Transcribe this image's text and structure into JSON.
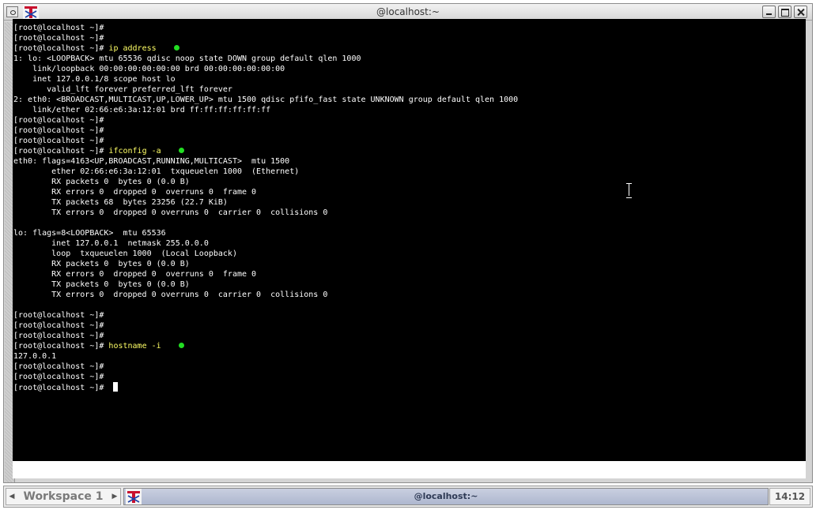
{
  "window": {
    "title": "@localhost:~"
  },
  "terminal": {
    "colors": {
      "background": "#000000",
      "text": "#ffffff",
      "command": "#ffff66",
      "marker": "#22dd22"
    },
    "lines": [
      {
        "text": "[root@localhost ~]#"
      },
      {
        "text": "[root@localhost ~]#"
      },
      {
        "text": "[root@localhost ~]# ",
        "cmd": "ip address",
        "marker": true
      },
      {
        "text": "1: lo: <LOOPBACK> mtu 65536 qdisc noop state DOWN group default qlen 1000"
      },
      {
        "text": "    link/loopback 00:00:00:00:00:00 brd 00:00:00:00:00:00"
      },
      {
        "text": "    inet 127.0.0.1/8 scope host lo"
      },
      {
        "text": "       valid_lft forever preferred_lft forever"
      },
      {
        "text": "2: eth0: <BROADCAST,MULTICAST,UP,LOWER_UP> mtu 1500 qdisc pfifo_fast state UNKNOWN group default qlen 1000"
      },
      {
        "text": "    link/ether 02:66:e6:3a:12:01 brd ff:ff:ff:ff:ff:ff"
      },
      {
        "text": "[root@localhost ~]#"
      },
      {
        "text": "[root@localhost ~]#"
      },
      {
        "text": "[root@localhost ~]#"
      },
      {
        "text": "[root@localhost ~]# ",
        "cmd": "ifconfig -a",
        "marker": true
      },
      {
        "text": "eth0: flags=4163<UP,BROADCAST,RUNNING,MULTICAST>  mtu 1500"
      },
      {
        "text": "        ether 02:66:e6:3a:12:01  txqueuelen 1000  (Ethernet)"
      },
      {
        "text": "        RX packets 0  bytes 0 (0.0 B)"
      },
      {
        "text": "        RX errors 0  dropped 0  overruns 0  frame 0"
      },
      {
        "text": "        TX packets 68  bytes 23256 (22.7 KiB)"
      },
      {
        "text": "        TX errors 0  dropped 0 overruns 0  carrier 0  collisions 0"
      },
      {
        "text": ""
      },
      {
        "text": "lo: flags=8<LOOPBACK>  mtu 65536"
      },
      {
        "text": "        inet 127.0.0.1  netmask 255.0.0.0"
      },
      {
        "text": "        loop  txqueuelen 1000  (Local Loopback)"
      },
      {
        "text": "        RX packets 0  bytes 0 (0.0 B)"
      },
      {
        "text": "        RX errors 0  dropped 0  overruns 0  frame 0"
      },
      {
        "text": "        TX packets 0  bytes 0 (0.0 B)"
      },
      {
        "text": "        TX errors 0  dropped 0 overruns 0  carrier 0  collisions 0"
      },
      {
        "text": ""
      },
      {
        "text": "[root@localhost ~]#"
      },
      {
        "text": "[root@localhost ~]#"
      },
      {
        "text": "[root@localhost ~]#"
      },
      {
        "text": "[root@localhost ~]# ",
        "cmd": "hostname -i",
        "marker": true
      },
      {
        "text": "127.0.0.1"
      },
      {
        "text": "[root@localhost ~]#"
      },
      {
        "text": "[root@localhost ~]#"
      },
      {
        "text": "[root@localhost ~]# ",
        "cursor": true
      }
    ]
  },
  "taskbar": {
    "workspace_label": "Workspace 1",
    "task_label": "@localhost:~",
    "clock": "14:12"
  }
}
